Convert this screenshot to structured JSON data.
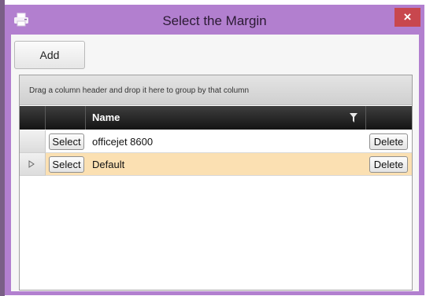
{
  "window": {
    "title": "Select the Margin",
    "close_glyph": "×",
    "app_icon": "printer-icon",
    "accent": "#b27fcf",
    "close_color": "#c8474e"
  },
  "toolbar": {
    "add_label": "Add"
  },
  "grid": {
    "group_panel_text": "Drag a column header and drop it here to group by that column",
    "columns": [
      "Name"
    ],
    "filter_icon": "filter-icon",
    "rows": [
      {
        "select_label": "Select",
        "name": "officejet 8600",
        "delete_label": "Delete",
        "selected": false
      },
      {
        "select_label": "Select",
        "name": "Default",
        "delete_label": "Delete",
        "selected": true
      }
    ],
    "selected_row_color": "#fbe0b2"
  }
}
